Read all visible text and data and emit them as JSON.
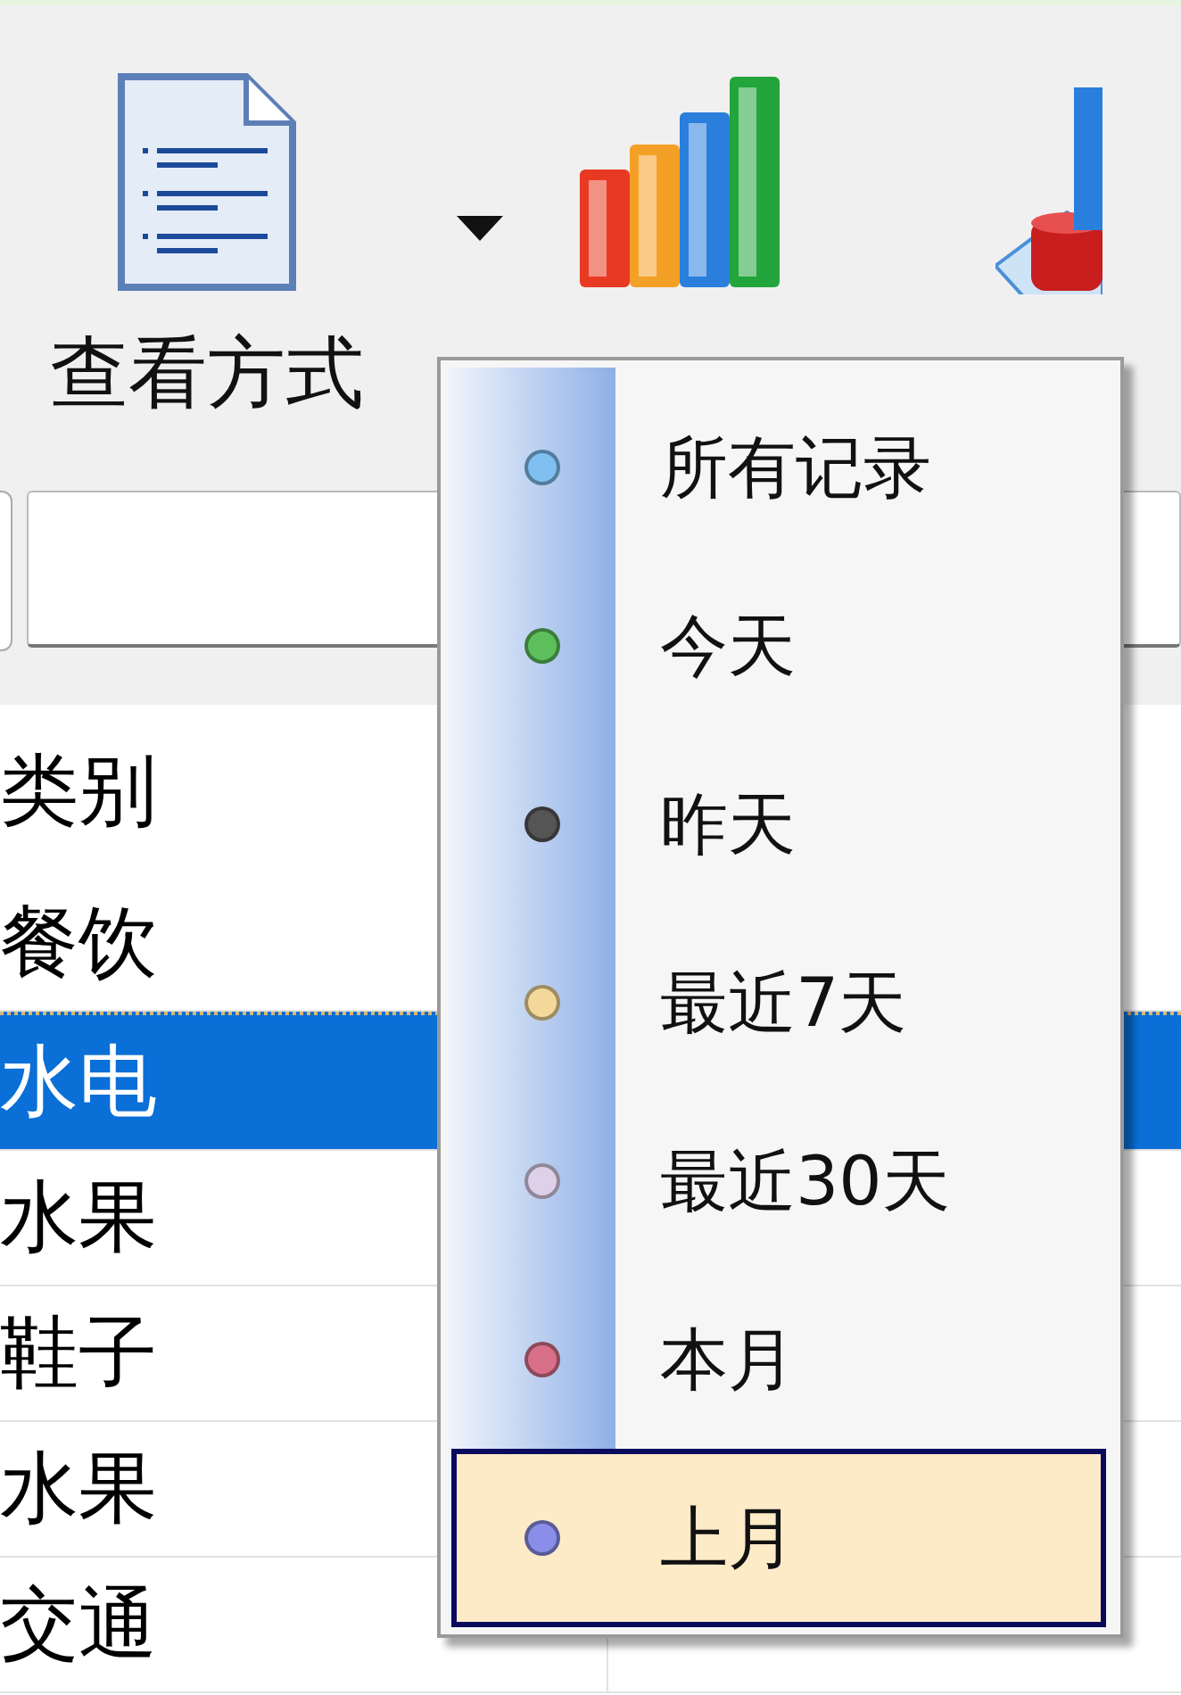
{
  "toolbar": {
    "tools": [
      {
        "label": "查看方式",
        "kind": "document",
        "dropdown": true
      },
      {
        "kind": "bar-chart",
        "dropdown": false
      },
      {
        "kind": "cube-chart",
        "dropdown": false
      }
    ]
  },
  "table": {
    "columns": [
      "类别"
    ],
    "rows": [
      {
        "cells": [
          "餐饮"
        ],
        "selected": false
      },
      {
        "cells": [
          "水电"
        ],
        "selected": true
      },
      {
        "cells": [
          "水果"
        ],
        "selected": false
      },
      {
        "cells": [
          "鞋子"
        ],
        "selected": false
      },
      {
        "cells": [
          "水果"
        ],
        "selected": false
      },
      {
        "cells": [
          "交通"
        ],
        "selected": false
      }
    ]
  },
  "menu": {
    "items": [
      {
        "label": "所有记录",
        "color": "#7fc0f0",
        "selected": false
      },
      {
        "label": "今天",
        "color": "#5cbf5c",
        "selected": false
      },
      {
        "label": "昨天",
        "color": "#555555",
        "selected": false
      },
      {
        "label": "最近7天",
        "color": "#f3d89a",
        "selected": false
      },
      {
        "label": "最近30天",
        "color": "#ddd0e8",
        "selected": false
      },
      {
        "label": "本月",
        "color": "#d9708a",
        "selected": false
      },
      {
        "label": "上月",
        "color": "#8a8ee8",
        "selected": true
      }
    ]
  }
}
